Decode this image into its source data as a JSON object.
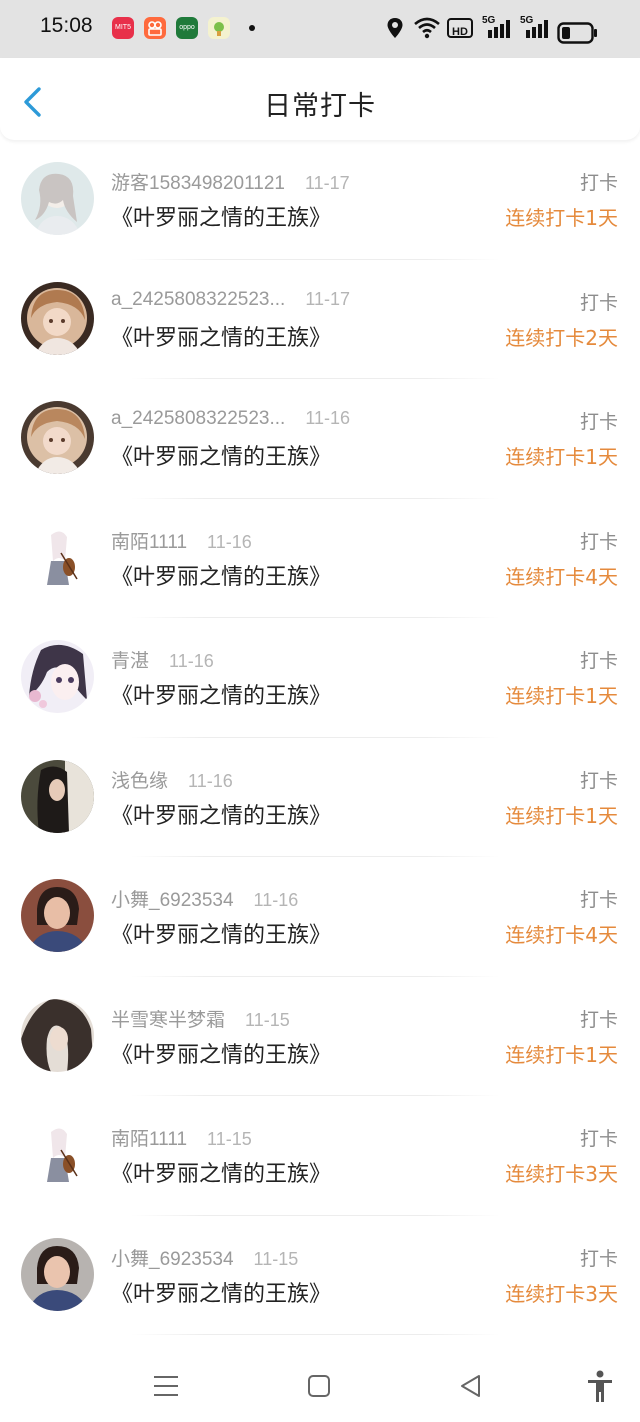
{
  "status_bar": {
    "time": "15:08",
    "apps": [
      {
        "icon": "mito-app-icon",
        "label": "MIT5",
        "color": "#e8304a"
      },
      {
        "icon": "video-app-icon",
        "label": "",
        "color": "#ff6a3d"
      },
      {
        "icon": "oppo-app-icon",
        "label": "oppo",
        "color": "#1f7a3a"
      },
      {
        "icon": "game-app-icon",
        "label": "",
        "color": "#f2f2cc"
      }
    ],
    "icons": [
      "location-icon",
      "wifi-icon",
      "hd-icon",
      "signal-5g-icon",
      "signal-5g-icon",
      "battery-icon"
    ],
    "hd_label": "HD",
    "net_label": "5G"
  },
  "header": {
    "title": "日常打卡",
    "back_icon": "chevron-left-icon"
  },
  "colors": {
    "accent": "#e58a3c",
    "back": "#2d9ad8"
  },
  "entries": [
    {
      "name": "游客1583498201121",
      "date": "11-17",
      "book": "《叶罗丽之情的王族》",
      "action": "打卡",
      "streak": "连续打卡1天"
    },
    {
      "name": "a_2425808322523...",
      "date": "11-17",
      "book": "《叶罗丽之情的王族》",
      "action": "打卡",
      "streak": "连续打卡2天"
    },
    {
      "name": "a_2425808322523...",
      "date": "11-16",
      "book": "《叶罗丽之情的王族》",
      "action": "打卡",
      "streak": "连续打卡1天"
    },
    {
      "name": "南陌1111",
      "date": "11-16",
      "book": "《叶罗丽之情的王族》",
      "action": "打卡",
      "streak": "连续打卡4天"
    },
    {
      "name": "青湛",
      "date": "11-16",
      "book": "《叶罗丽之情的王族》",
      "action": "打卡",
      "streak": "连续打卡1天"
    },
    {
      "name": "浅色缘",
      "date": "11-16",
      "book": "《叶罗丽之情的王族》",
      "action": "打卡",
      "streak": "连续打卡1天"
    },
    {
      "name": "小舞_6923534",
      "date": "11-16",
      "book": "《叶罗丽之情的王族》",
      "action": "打卡",
      "streak": "连续打卡4天"
    },
    {
      "name": "半雪寒半梦霜",
      "date": "11-15",
      "book": "《叶罗丽之情的王族》",
      "action": "打卡",
      "streak": "连续打卡1天"
    },
    {
      "name": "南陌1111",
      "date": "11-15",
      "book": "《叶罗丽之情的王族》",
      "action": "打卡",
      "streak": "连续打卡3天"
    },
    {
      "name": "小舞_6923534",
      "date": "11-15",
      "book": "《叶罗丽之情的王族》",
      "action": "打卡",
      "streak": "连续打卡3天"
    }
  ],
  "nav_bar": {
    "icons": [
      "menu-icon",
      "home-square-icon",
      "back-triangle-icon",
      "accessibility-icon"
    ]
  }
}
